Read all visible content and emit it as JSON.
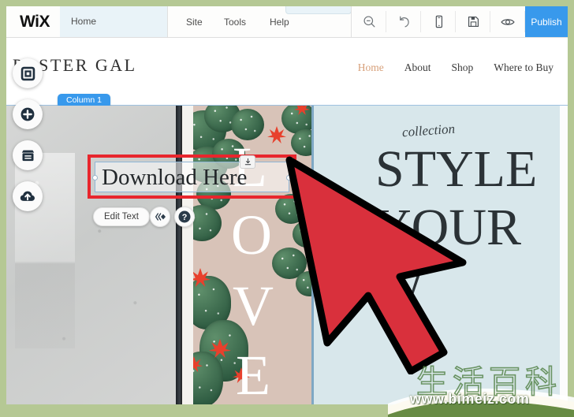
{
  "toolbar": {
    "brand": "WiX",
    "current_page": "Home",
    "menus": [
      {
        "label": "Site",
        "name": "menu-site"
      },
      {
        "label": "Tools",
        "name": "menu-tools"
      },
      {
        "label": "Help",
        "name": "menu-help"
      }
    ],
    "icons": [
      {
        "name": "zoom-out-icon",
        "title": "Zoom Out & Reorder"
      },
      {
        "name": "undo-icon",
        "title": "Undo"
      },
      {
        "name": "mobile-view-icon",
        "title": "Mobile Editor"
      },
      {
        "name": "save-icon",
        "title": "Save"
      },
      {
        "name": "preview-eye-icon",
        "title": "Preview"
      }
    ],
    "publish_label": "Publish",
    "accent_color": "#3899ec"
  },
  "sidebar": {
    "items": [
      {
        "label": "Menus & Pages",
        "icon": "pages-square-icon"
      },
      {
        "label": "Add",
        "icon": "plus-circle-icon"
      },
      {
        "label": "Add Apps",
        "icon": "store-icon"
      },
      {
        "label": "My Uploads",
        "icon": "upload-cloud-icon"
      }
    ]
  },
  "site": {
    "logo_text": "POSTER GAL",
    "nav": [
      {
        "label": "Home",
        "active": true
      },
      {
        "label": "About",
        "active": false
      },
      {
        "label": "Shop",
        "active": false
      },
      {
        "label": "Where to Buy",
        "active": false
      }
    ],
    "nav_active_color": "#d7a07a"
  },
  "editor": {
    "column_tab_label": "Column 1",
    "selected_text": "Download Here",
    "selection_color": "#e8262d",
    "edit_text_label": "Edit Text",
    "animation_icon": "animation-icon",
    "help_icon": "help-question-icon",
    "download_icon": "download-icon"
  },
  "poster": {
    "letters": [
      "L",
      "O",
      "V",
      "E"
    ],
    "background_color": "#d8c3b8"
  },
  "hero": {
    "script_text": "collection",
    "lines": [
      "STYLE",
      "YOUR",
      "W"
    ],
    "background_color": "#d8e7eb"
  },
  "cursor": {
    "name": "mouse-pointer-arrow",
    "fill_color": "#d9303c",
    "stroke_color": "#000000"
  },
  "watermark": {
    "cjk_text": "生活百科",
    "url_text": "www.bimeiz.com"
  }
}
